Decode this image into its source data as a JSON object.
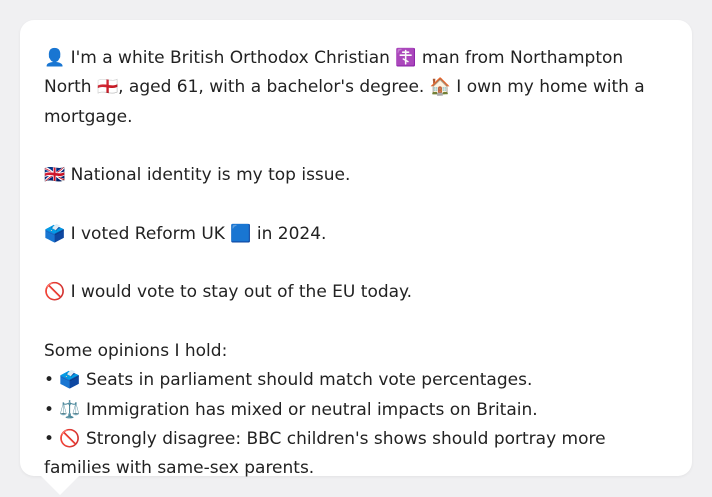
{
  "profile": {
    "intro": "👤 I'm a white British Orthodox Christian ☦️ man from Northampton North 🏴󠁧󠁢󠁥󠁮󠁧󠁿, aged 61, with a bachelor's degree. 🏠 I own my home with a mortgage.",
    "identity": "🇬🇧 National identity is my top issue.",
    "vote": "🗳️ I voted Reform UK 🟦 in 2024.",
    "eu": "🚫 I would vote to stay out of the EU today."
  },
  "opinions": {
    "heading": "Some opinions I hold:",
    "items": [
      "• 🗳️ Seats in parliament should match vote percentages.",
      "• ⚖️ Immigration has mixed or neutral impacts on Britain.",
      "• 🚫 Strongly disagree: BBC children's shows should portray more families with same-sex parents."
    ]
  },
  "colors": {
    "background": "#f0f0f2",
    "bubble": "#ffffff",
    "text": "#222222"
  }
}
